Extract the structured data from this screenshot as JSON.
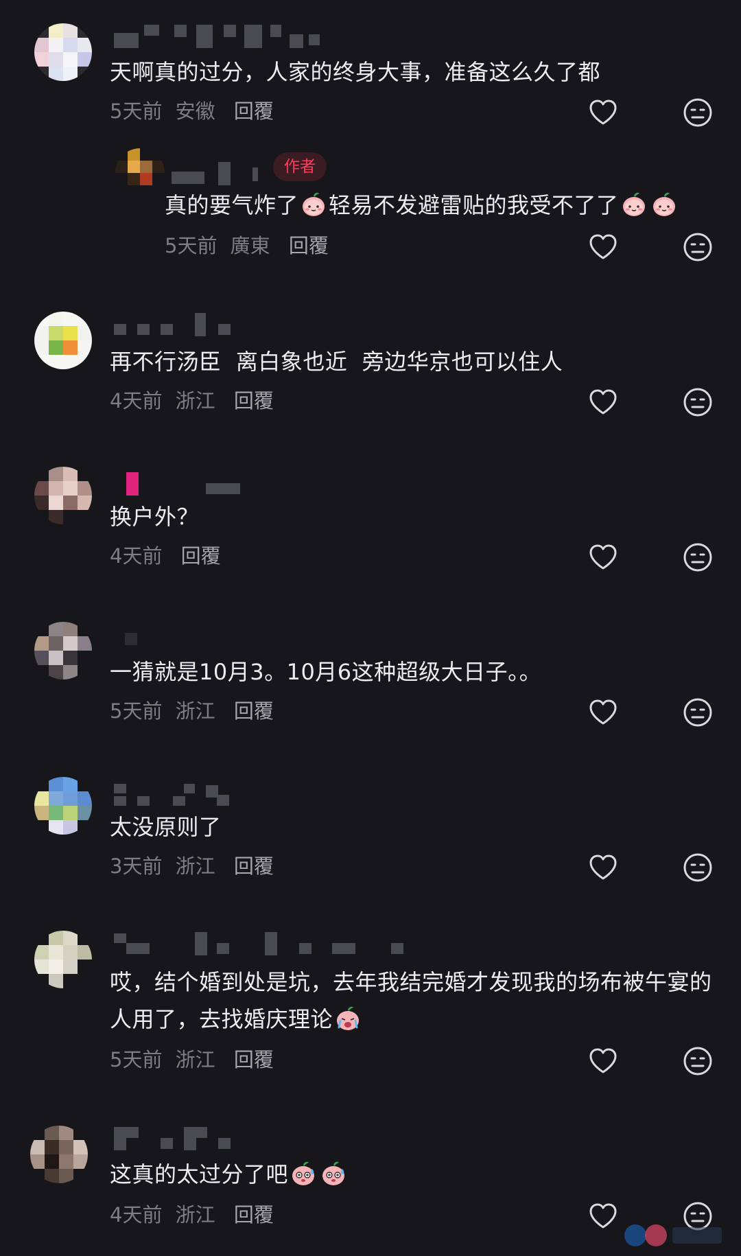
{
  "comments": [
    {
      "text": "天啊真的过分，人家的终身大事，准备这么久了都",
      "time": "5天前",
      "location": "安徽",
      "reply_label": "回覆",
      "avatar_colors": [
        "#2a2a30",
        "#f2efc8",
        "#e9e0e4",
        "#2a2a30",
        "#e2c6d2",
        "#f3f1f4",
        "#d7d9ef",
        "#eae8ef",
        "#f1d2da",
        "#e1dcec",
        "#f5f4f7",
        "#c7c6e8",
        "#2a2a30",
        "#dbe2f2",
        "#f0f1f7",
        "#2a2a30"
      ]
    },
    {
      "is_reply": true,
      "author_badge": "作者",
      "text_parts": [
        "真的要气炸了",
        "轻易不发避雷贴的我受不了了",
        ""
      ],
      "time": "5天前",
      "location": "廣東",
      "reply_label": "回覆",
      "avatar_colors": [
        "#16161b",
        "#c79227",
        "#16161b",
        "#16161b",
        "#2c2119",
        "#e7a94a",
        "#9a6a3a",
        "#2e2218",
        "#16161b",
        "#3a2616",
        "#b13a22",
        "#16161b",
        "#16161b",
        "#16161b",
        "#16161b",
        "#16161b"
      ]
    },
    {
      "text": "再不行汤臣  离白象也近  旁边华京也可以住人",
      "time": "4天前",
      "location": "浙江",
      "reply_label": "回覆",
      "avatar_colors": [
        "#f7f7f4",
        "#f5f5f0",
        "#f7f7f2",
        "#f5f5f5",
        "#f2f2f0",
        "#c9d96a",
        "#e9e24a",
        "#f2f2ef",
        "#f2f2f0",
        "#79b54a",
        "#ef8f3a",
        "#f4f4f1",
        "#f7f7f4",
        "#f7f7f4",
        "#f7f7f4",
        "#f5f5f2"
      ]
    },
    {
      "text": "换户外？",
      "time": "4天前",
      "location": "",
      "reply_label": "回覆",
      "avatar_colors": [
        "#16161b",
        "#a88f8a",
        "#d9bdb5",
        "#16161b",
        "#6c4a4a",
        "#d3b4ae",
        "#e6d1c9",
        "#b08f88",
        "#3b2a2a",
        "#ecd8d2",
        "#8b6b66",
        "#d5b8b0",
        "#16161b",
        "#3c2b2b",
        "#16161b",
        "#16161b"
      ]
    },
    {
      "text": "一猜就是10月3。10月6这种超级大日子。。",
      "time": "5天前",
      "location": "浙江",
      "reply_label": "回覆",
      "avatar_colors": [
        "#16161b",
        "#8d8488",
        "#8f7f7a",
        "#16161b",
        "#b29a86",
        "#6d6365",
        "#d3c9c6",
        "#8a7f88",
        "#56505a",
        "#c9c1c3",
        "#39343b",
        "#16161b",
        "#16161b",
        "#4b4346",
        "#8e8586",
        "#16161b"
      ]
    },
    {
      "text": "太没原则了",
      "time": "3天前",
      "location": "浙江",
      "reply_label": "回覆",
      "avatar_colors": [
        "#16161b",
        "#5a8fd6",
        "#6aa2e6",
        "#16161b",
        "#e9e6a0",
        "#7fa9d6",
        "#6f9dd9",
        "#5c8ccf",
        "#c9b67e",
        "#77b978",
        "#bcd37a",
        "#6b8fa3",
        "#16161b",
        "#e8e3f2",
        "#c8c6e3",
        "#16161b"
      ]
    },
    {
      "text_parts": [
        "哎，结个婚到处是坑，去年我结完婚才发现我的场布被午宴的人用了，去找婚庆理论",
        ""
      ],
      "time": "5天前",
      "location": "浙江",
      "reply_label": "回覆",
      "avatar_colors": [
        "#16161b",
        "#c7c8a8",
        "#dcd7c6",
        "#16161b",
        "#cfd2b2",
        "#e8e6d9",
        "#d4d1c0",
        "#bdbba4",
        "#e5e4d9",
        "#f1efe6",
        "#d3d1c7",
        "#16161b",
        "#16161b",
        "#cbc9bd",
        "#16161b",
        "#16161b"
      ]
    },
    {
      "text_parts": [
        "这真的太过分了吧",
        "",
        ""
      ],
      "time": "4天前",
      "location": "浙江",
      "reply_label": "回覆",
      "avatar_colors": [
        "#16161b",
        "#6a5a52",
        "#9e8a80",
        "#16161b",
        "#c9bbb2",
        "#3b2c26",
        "#7a655c",
        "#d2c2b8",
        "#a69187",
        "#1f1715",
        "#8d786e",
        "#b8a69c",
        "#16161b",
        "#4a3a34",
        "#6b5a52",
        "#16161b"
      ]
    }
  ],
  "icons": {
    "like": "heart-outline-icon",
    "dislike": "meh-face-icon"
  },
  "colors": {
    "background": "#16161b",
    "text": "#ecedf1",
    "meta": "#7c7d86",
    "author_badge": "#ff3b5c"
  }
}
